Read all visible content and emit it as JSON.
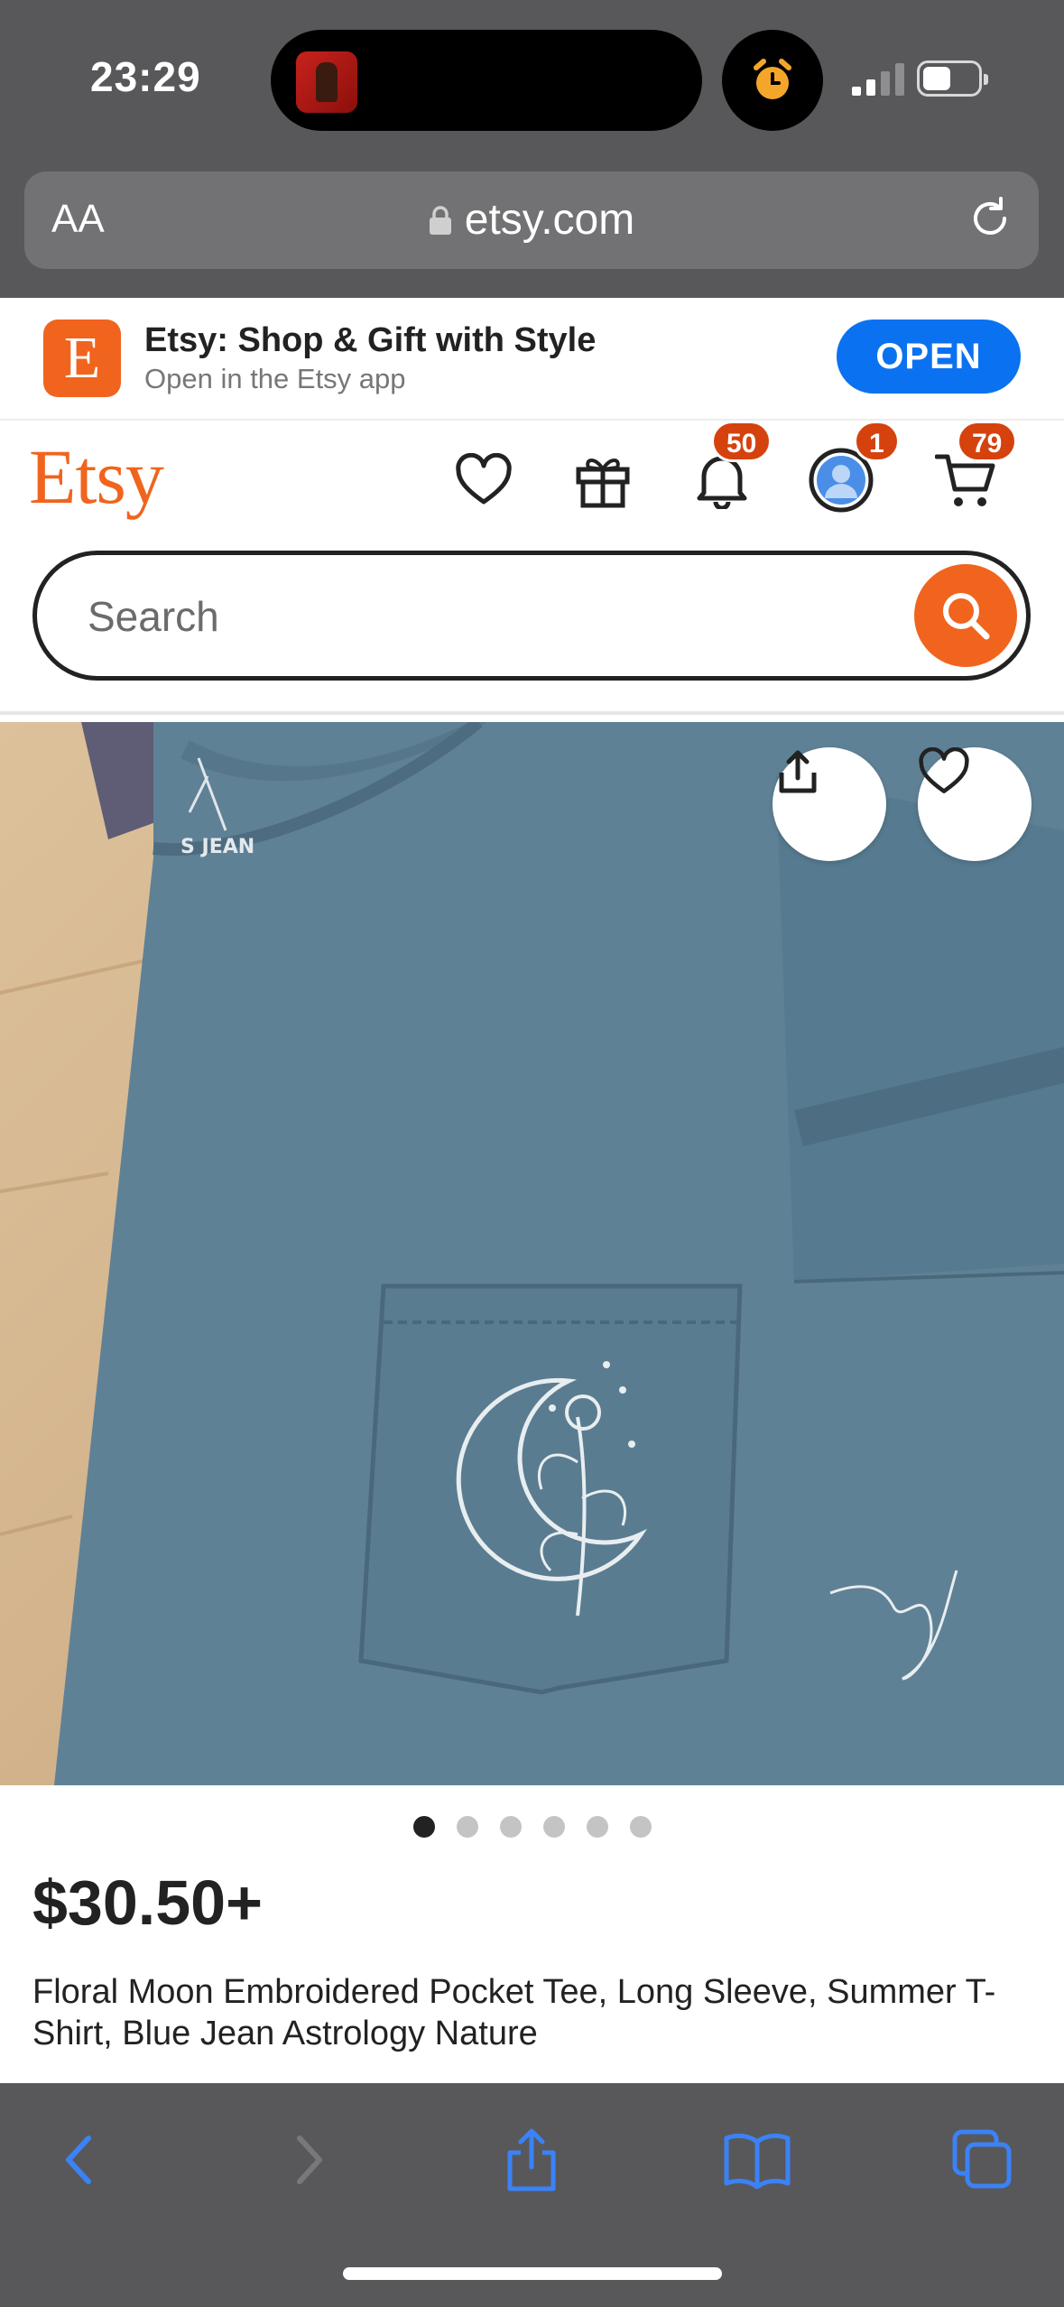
{
  "status_bar": {
    "time": "23:29",
    "icons": [
      "now-playing-art",
      "alarm-icon",
      "signal-icon",
      "battery-icon"
    ]
  },
  "browser": {
    "url_text_size_label": "AA",
    "url": "etsy.com",
    "icons": [
      "lock-icon",
      "reload-icon"
    ]
  },
  "app_banner": {
    "icon_letter": "E",
    "title": "Etsy: Shop & Gift with Style",
    "subtitle": "Open in the Etsy app",
    "open_label": "OPEN"
  },
  "header": {
    "logo": "Etsy",
    "notifications_count": "50",
    "account_count": "1",
    "cart_count": "79",
    "icons": [
      "heart-icon",
      "gift-icon",
      "bell-icon",
      "avatar-icon",
      "cart-icon"
    ]
  },
  "search": {
    "placeholder": "Search"
  },
  "product": {
    "image_count": 6,
    "active_image_index": 0,
    "price": "$30.50+",
    "title": "Floral Moon Embroidered Pocket Tee, Long Sleeve, Summer T-Shirt, Blue Jean Astrology Nature",
    "label_text": "S JEAN",
    "signature_text": "sj"
  },
  "colors": {
    "etsy_orange": "#f1641e",
    "open_blue": "#0a72f0",
    "badge_red": "#d5420e",
    "safari_chrome": "#58585a",
    "toolbar_blue": "#3b82f6",
    "shirt_blue": "#5f8196"
  },
  "toolbar": {
    "icons": [
      "back-icon",
      "forward-icon",
      "share-icon",
      "bookmarks-icon",
      "tabs-icon"
    ]
  }
}
